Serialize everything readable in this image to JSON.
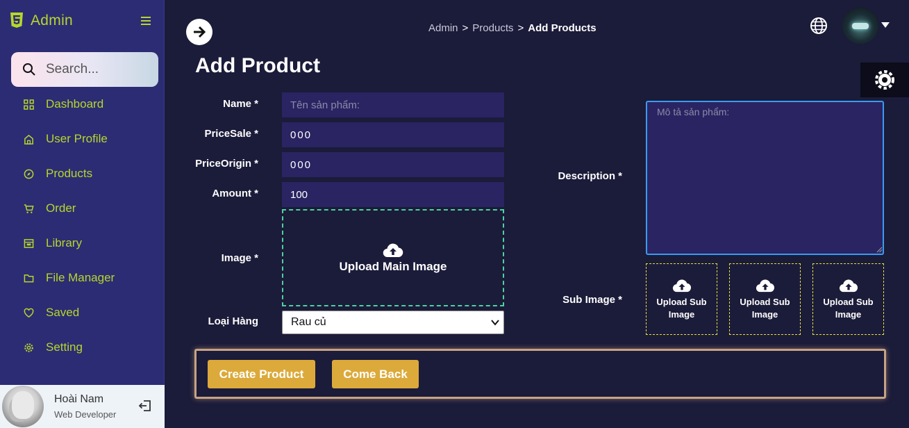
{
  "sidebar": {
    "brand": "Admin",
    "search_placeholder": "Search...",
    "items": [
      {
        "label": "Dashboard",
        "icon": "grid-icon"
      },
      {
        "label": "User Profile",
        "icon": "home-icon"
      },
      {
        "label": "Products",
        "icon": "compass-icon"
      },
      {
        "label": "Order",
        "icon": "cart-icon"
      },
      {
        "label": "Library",
        "icon": "book-icon"
      },
      {
        "label": "File Manager",
        "icon": "folder-icon"
      },
      {
        "label": "Saved",
        "icon": "heart-icon"
      },
      {
        "label": "Setting",
        "icon": "gear-icon"
      }
    ],
    "profile": {
      "name": "Hoài Nam",
      "role": "Web Developer"
    }
  },
  "header": {
    "breadcrumb": [
      "Admin",
      "Products",
      "Add Products"
    ],
    "separator": ">"
  },
  "page": {
    "title": "Add Product"
  },
  "form": {
    "name": {
      "label": "Name *",
      "placeholder": "Tên sản phẩm:",
      "value": ""
    },
    "price_sale": {
      "label": "PriceSale *",
      "value": "000"
    },
    "price_origin": {
      "label": "PriceOrigin *",
      "value": "000"
    },
    "amount": {
      "label": "Amount *",
      "value": "100"
    },
    "image": {
      "label": "Image *",
      "upload_text": "Upload Main Image"
    },
    "category": {
      "label": "Loại Hàng",
      "selected": "Rau củ"
    },
    "description": {
      "label": "Description *",
      "placeholder": "Mô tả sản phẩm:"
    },
    "sub_image": {
      "label": "Sub Image *",
      "upload_text": [
        "Upload Sub Image",
        "Upload Sub Image",
        "Upload Sub Image"
      ]
    }
  },
  "actions": {
    "create": "Create Product",
    "back": "Come Back"
  },
  "colors": {
    "accent": "#b7d62b",
    "button": "#dcaa3a",
    "sidebar": "#2c2c74",
    "background": "#1b1b3a"
  }
}
